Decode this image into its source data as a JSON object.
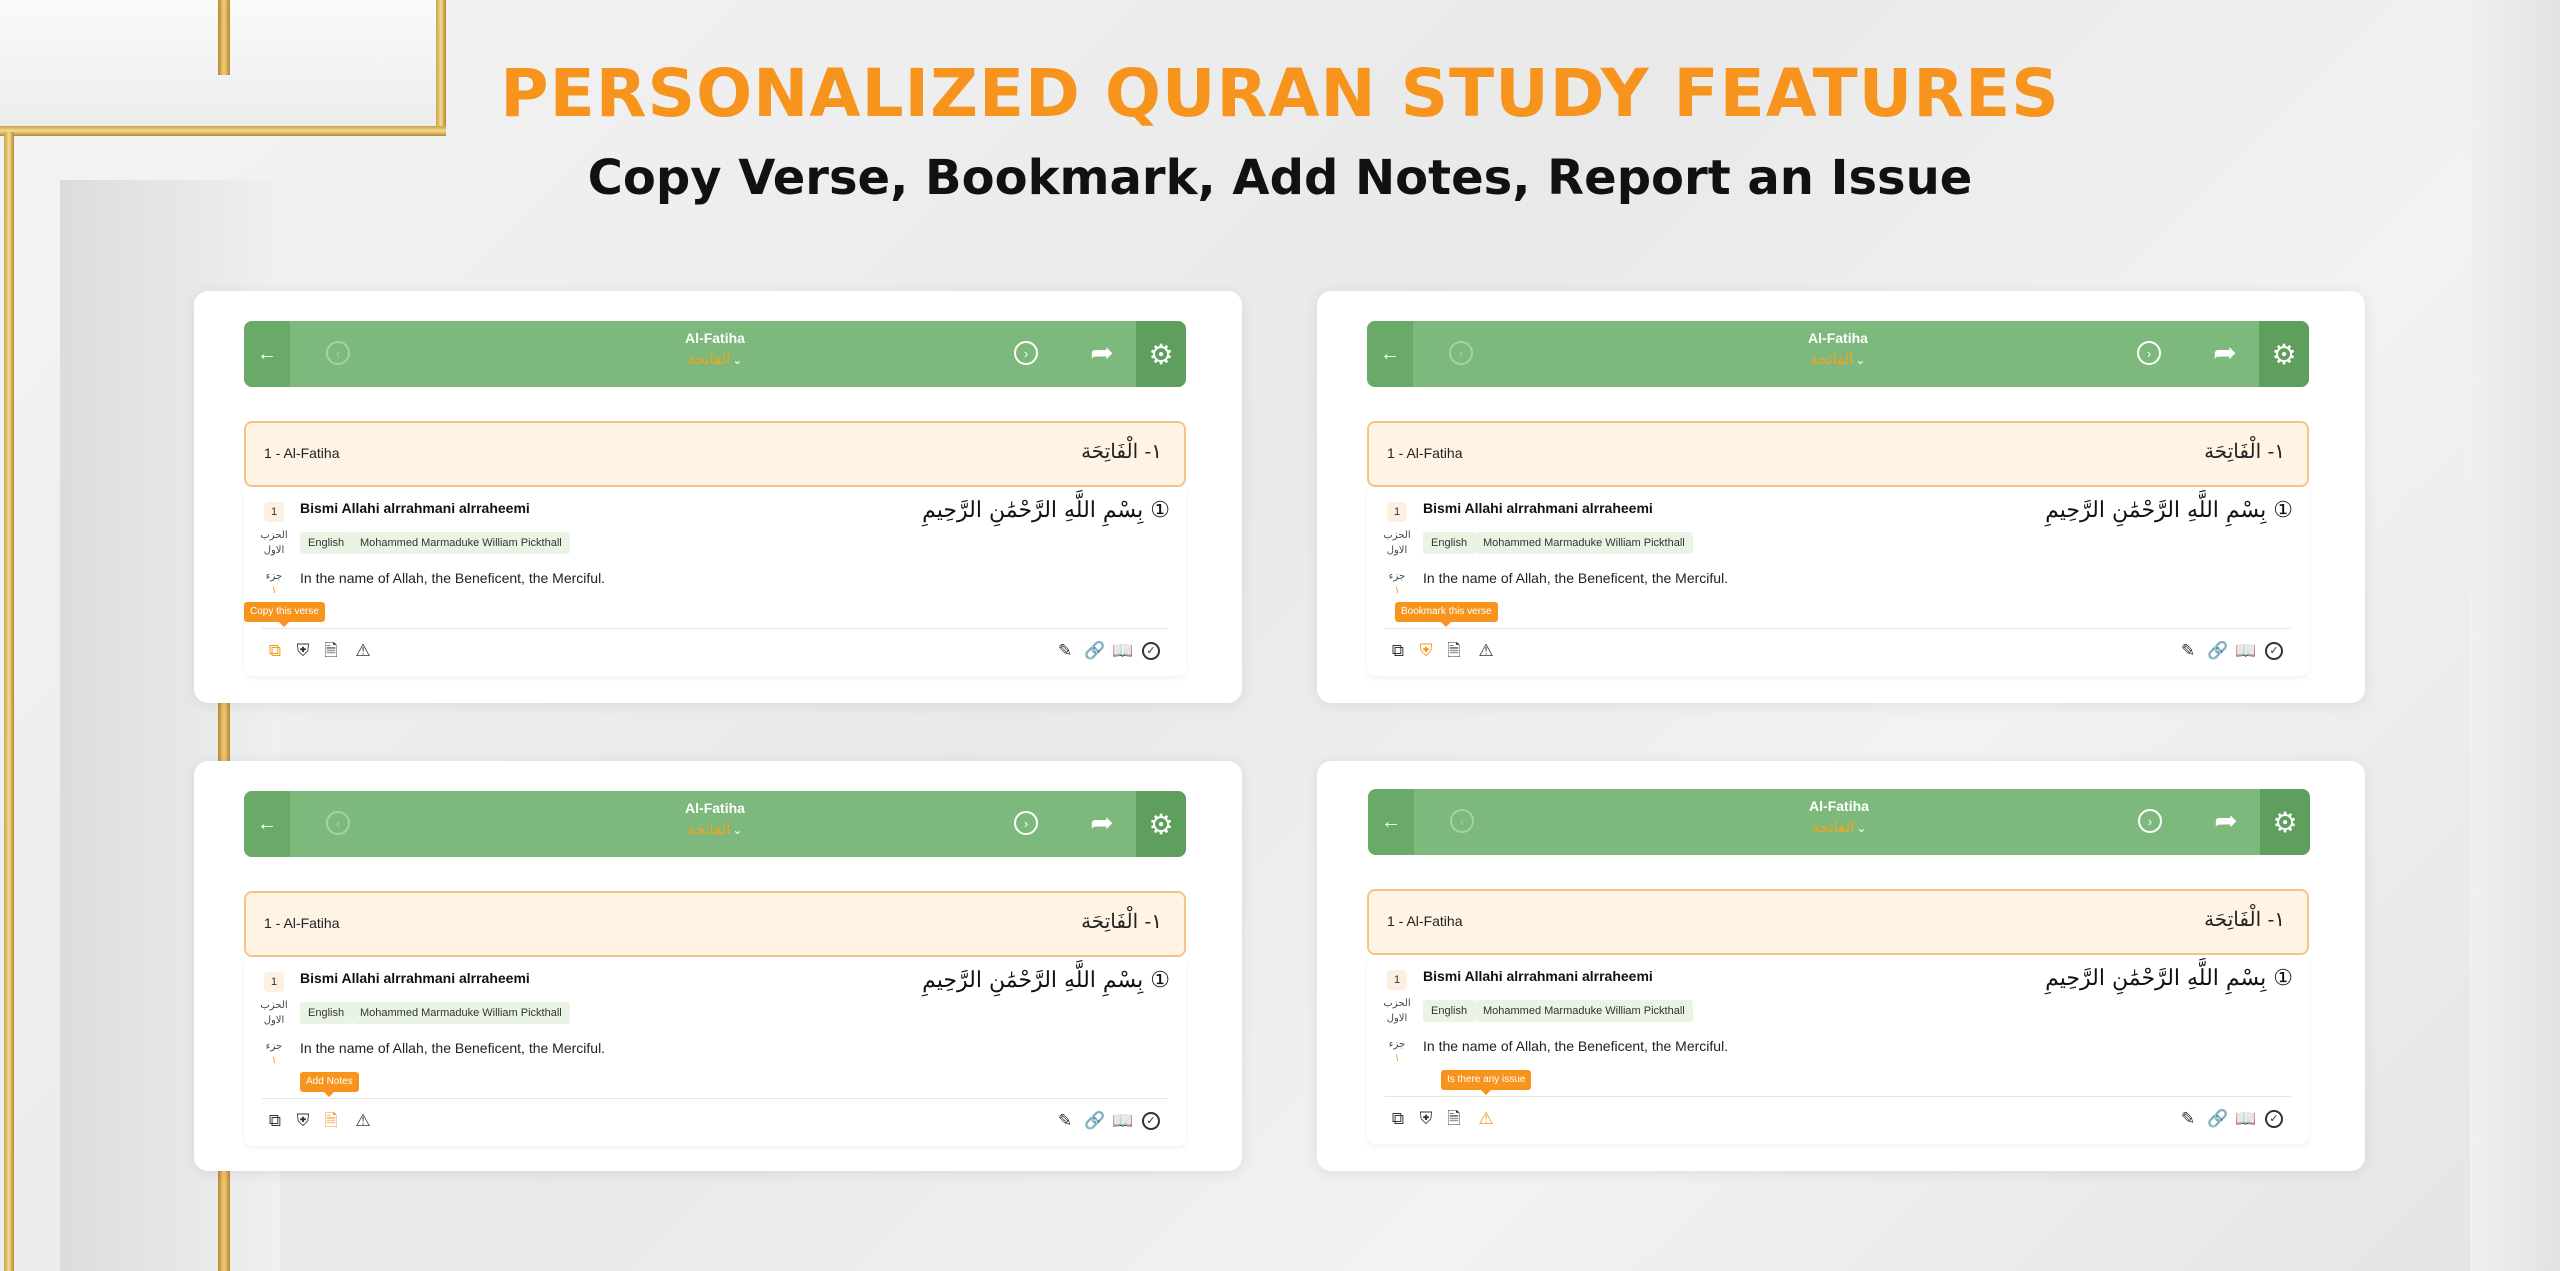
{
  "header": {
    "title": "PERSONALIZED QURAN STUDY FEATURES",
    "subtitle": "Copy Verse, Bookmark, Add Notes, Report an Issue"
  },
  "common": {
    "surah_title": "Al-Fatiha",
    "surah_subtitle": "الفاتحة",
    "surah_row_name": "1 - Al-Fatiha",
    "surah_row_arabic": "١- الْفَاتِحَة",
    "verse_number": "1",
    "juz_label": "الحزب الاول",
    "juz_label2": "جزء",
    "juz_num": "١",
    "transliteration": "Bismi Allahi alrrahmani alrraheemi",
    "arabic_verse": "بِسْمِ اللَّهِ الرَّحْمَٰنِ الرَّحِيمِ ①",
    "language_tag": "English",
    "translator_tag": "Mohammed Marmaduke William Pickthall",
    "translation": "In the name of Allah, the Beneficent, the Merciful."
  },
  "cards": [
    {
      "tooltip": "Copy this verse",
      "highlight": "copy"
    },
    {
      "tooltip": "Bookmark this verse",
      "highlight": "bookmark"
    },
    {
      "tooltip": "Add Notes",
      "highlight": "notes"
    },
    {
      "tooltip": "Is there any issue",
      "highlight": "report"
    }
  ],
  "icons": [
    "arrow-left-icon",
    "chevron-left-circle-icon",
    "chevron-right-circle-icon",
    "share-icon",
    "gear-icon",
    "copy-icon",
    "bookmark-icon",
    "notes-icon",
    "warning-icon",
    "pen-icon",
    "link-icon",
    "book-icon",
    "check-circle-icon"
  ],
  "colors": {
    "accent": "#f7941d",
    "green": "#7db97c",
    "surah_bg": "#fff3e4"
  }
}
